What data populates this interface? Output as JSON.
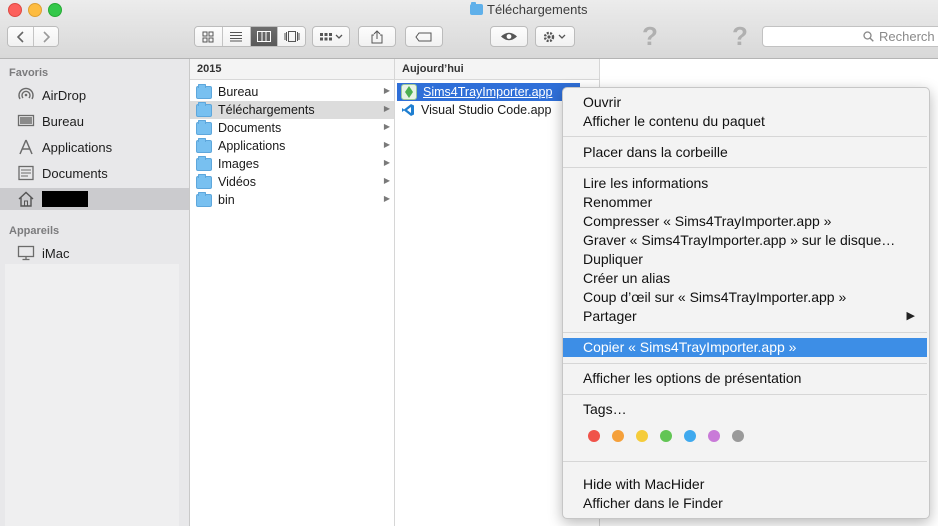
{
  "window": {
    "title": "Téléchargements"
  },
  "toolbar": {
    "search_placeholder": "Recherch",
    "help_icon_1": "question-icon",
    "help_icon_2": "question-icon"
  },
  "sidebar": {
    "favorites_header": "Favoris",
    "favorites": [
      {
        "label": "AirDrop",
        "icon": "airdrop-icon"
      },
      {
        "label": "Bureau",
        "icon": "desktop-icon"
      },
      {
        "label": "Applications",
        "icon": "applications-icon"
      },
      {
        "label": "Documents",
        "icon": "documents-icon"
      }
    ],
    "home_icon": "home-icon",
    "devices_header": "Appareils",
    "devices": [
      {
        "label": "iMac",
        "icon": "imac-icon"
      }
    ]
  },
  "columns": {
    "col1_header": "2015",
    "col1_items": [
      {
        "label": "Bureau"
      },
      {
        "label": "Téléchargements"
      },
      {
        "label": "Documents"
      },
      {
        "label": "Applications"
      },
      {
        "label": "Images"
      },
      {
        "label": "Vidéos"
      },
      {
        "label": "bin"
      }
    ],
    "col2_header": "Aujourd’hui",
    "col2_items": [
      {
        "label": "Sims4TrayImporter.app"
      },
      {
        "label": "Visual Studio Code.app"
      }
    ]
  },
  "context_menu": {
    "open": "Ouvrir",
    "show_package": "Afficher le contenu du paquet",
    "trash": "Placer dans la corbeille",
    "get_info": "Lire les informations",
    "rename": "Renommer",
    "compress": "Compresser « Sims4TrayImporter.app »",
    "burn": "Graver « Sims4TrayImporter.app » sur le disque…",
    "duplicate": "Dupliquer",
    "alias": "Créer un alias",
    "quicklook": "Coup d’œil sur « Sims4TrayImporter.app »",
    "share": "Partager",
    "copy": "Copier « Sims4TrayImporter.app »",
    "view_options": "Afficher les options de présentation",
    "tags": "Tags…",
    "tag_colors": [
      "#f0534a",
      "#f5a03a",
      "#f5cc3a",
      "#62c554",
      "#3fa9ee",
      "#c97ad8",
      "#9a9a9a"
    ],
    "machider": "Hide with MacHider",
    "reveal": "Afficher dans le Finder"
  }
}
